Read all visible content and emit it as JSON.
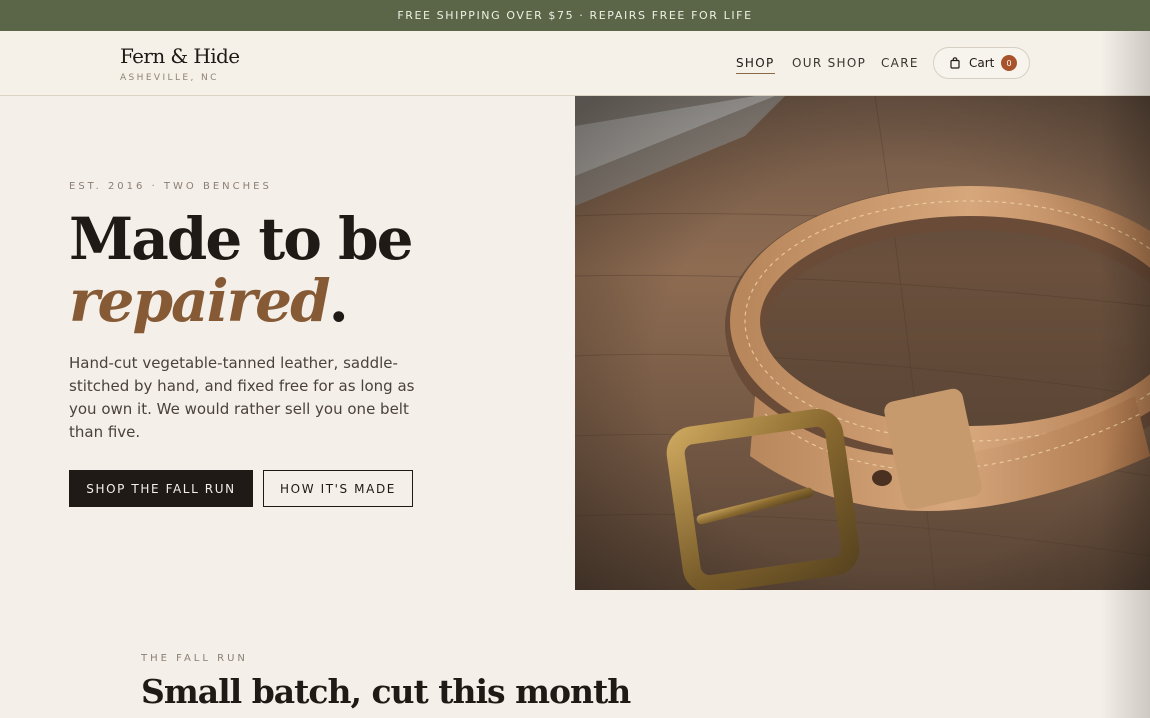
{
  "announcement": "FREE SHIPPING OVER $75 · REPAIRS FREE FOR LIFE",
  "brand": {
    "name": "Fern & Hide",
    "location": "ASHEVILLE, NC"
  },
  "nav": {
    "items": [
      {
        "label": "SHOP",
        "active": true
      },
      {
        "label": "OUR SHOP",
        "active": false
      },
      {
        "label": "CARE",
        "active": false
      }
    ]
  },
  "cart": {
    "label": "Cart",
    "count": "0",
    "icon": "shopping-bag-icon"
  },
  "hero": {
    "eyebrow": "EST. 2016 · TWO BENCHES",
    "headline_line1": "Made to be",
    "headline_em": "repaired",
    "headline_period": ".",
    "lede": "Hand-cut vegetable-tanned leather, saddle-stitched by hand, and fixed free for as long as you own it. We would rather sell you one belt than five.",
    "primary_cta": "SHOP THE FALL RUN",
    "secondary_cta": "HOW IT'S MADE",
    "image": "leather-belt-with-brass-buckle"
  },
  "section": {
    "eyebrow": "THE FALL RUN",
    "title": "Small batch, cut this month"
  },
  "colors": {
    "announce_bg": "#5b6648",
    "page_bg": "#f4efe8",
    "accent": "#855a35",
    "badge": "#a8532c",
    "ink": "#1f1a16"
  }
}
